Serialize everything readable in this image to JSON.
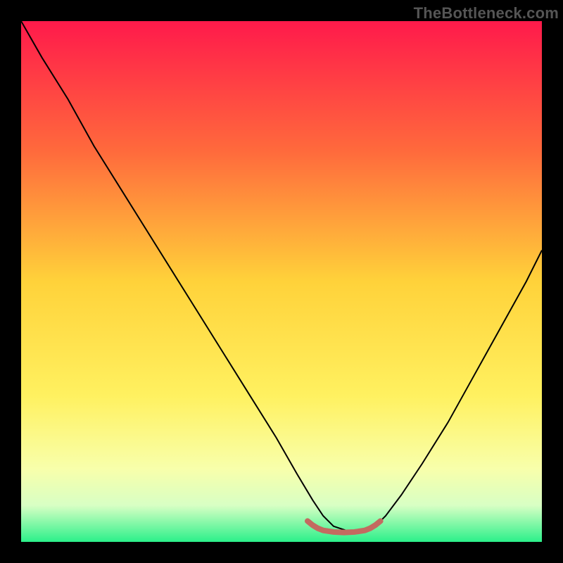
{
  "watermark": "TheBottleneck.com",
  "chart_data": {
    "type": "line",
    "title": "",
    "xlabel": "",
    "ylabel": "",
    "xlim": [
      0,
      100
    ],
    "ylim": [
      0,
      100
    ],
    "background_gradient_stops": [
      {
        "offset": 0,
        "color": "#ff1a4b"
      },
      {
        "offset": 25,
        "color": "#ff6a3c"
      },
      {
        "offset": 50,
        "color": "#ffd23a"
      },
      {
        "offset": 72,
        "color": "#fff160"
      },
      {
        "offset": 86,
        "color": "#f8ffab"
      },
      {
        "offset": 93,
        "color": "#d8ffc4"
      },
      {
        "offset": 100,
        "color": "#2bf08a"
      }
    ],
    "series": [
      {
        "name": "bottleneck-curve",
        "stroke": "#000000",
        "stroke_width": 2,
        "x": [
          0,
          4,
          9,
          14,
          19,
          24,
          29,
          34,
          39,
          44,
          49,
          53,
          56,
          58,
          60,
          63,
          66,
          68,
          70,
          73,
          77,
          82,
          87,
          92,
          97,
          100
        ],
        "y": [
          100,
          93,
          85,
          76,
          68,
          60,
          52,
          44,
          36,
          28,
          20,
          13,
          8,
          5,
          3,
          2,
          2,
          3,
          5,
          9,
          15,
          23,
          32,
          41,
          50,
          56
        ]
      },
      {
        "name": "optimal-band-marker",
        "stroke": "#c36a60",
        "stroke_width": 8,
        "x": [
          55,
          56,
          57,
          58,
          60,
          62,
          64,
          66,
          67,
          68,
          69
        ],
        "y": [
          4,
          3.2,
          2.6,
          2.2,
          1.9,
          1.8,
          1.9,
          2.2,
          2.6,
          3.2,
          4
        ]
      }
    ],
    "annotations": []
  }
}
